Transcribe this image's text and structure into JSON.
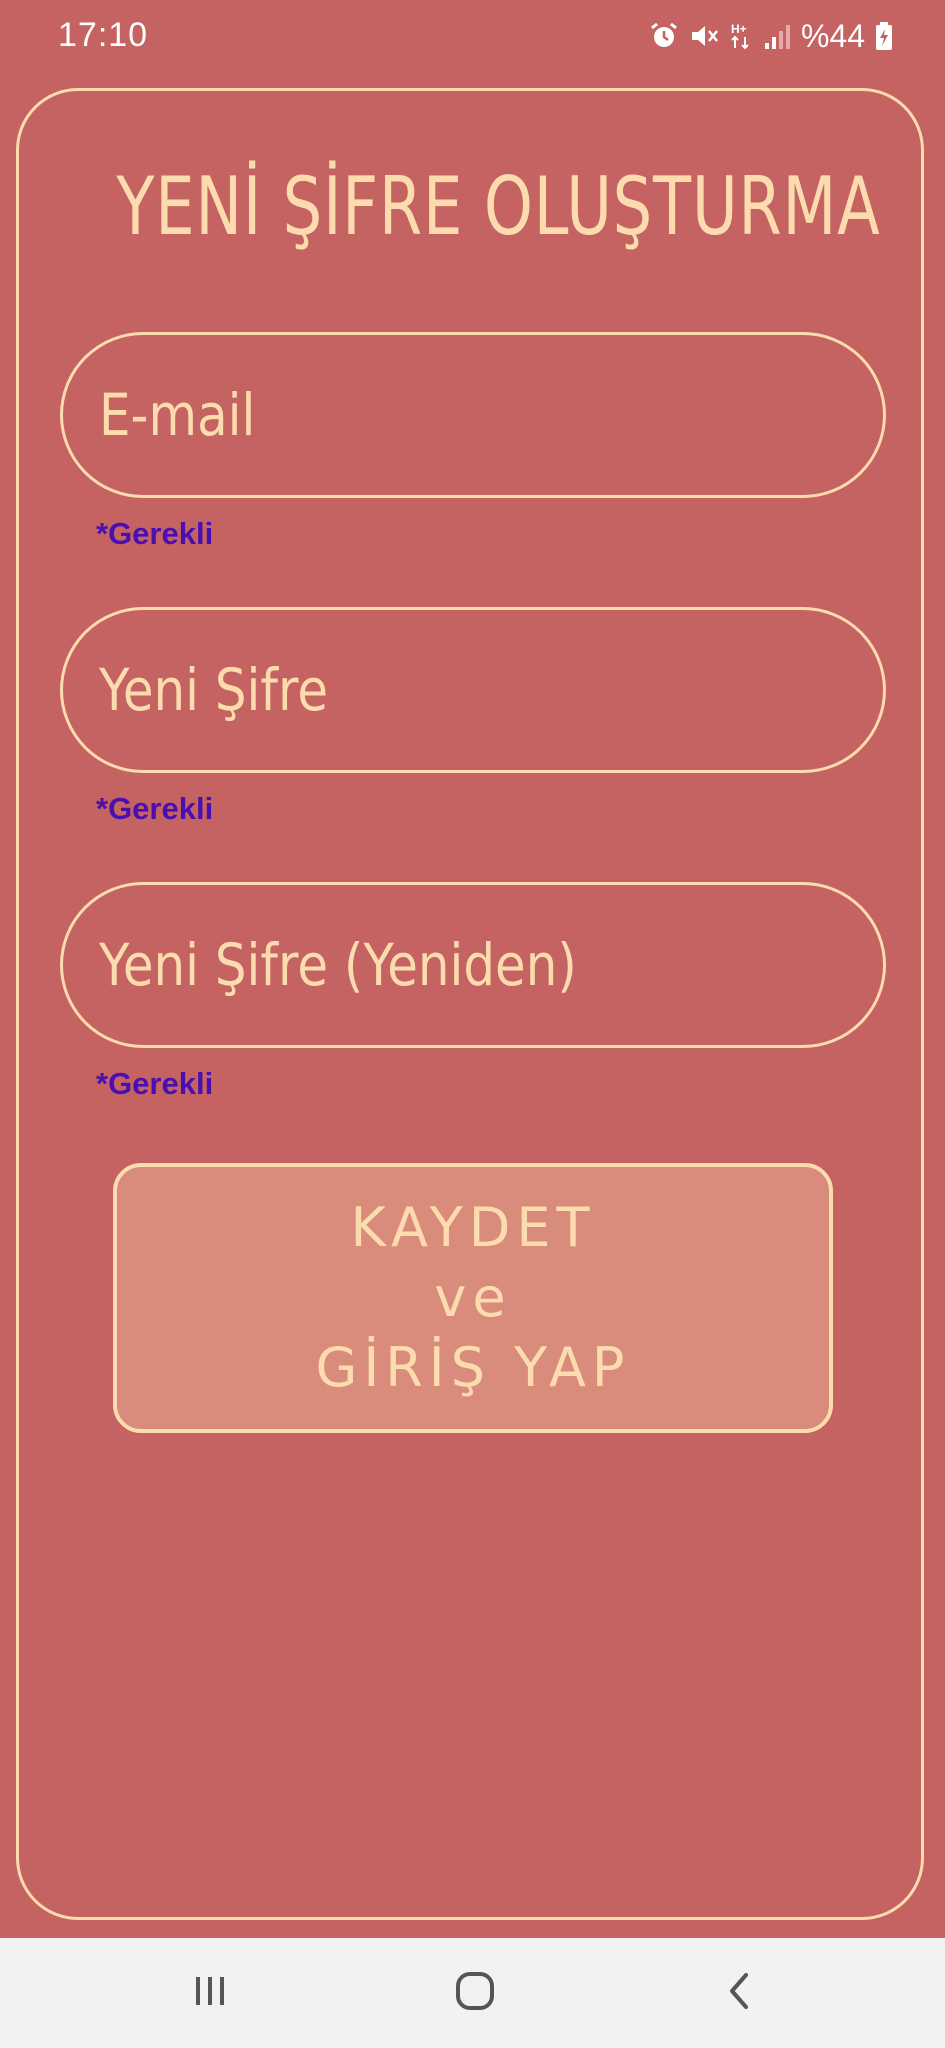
{
  "status_bar": {
    "time": "17:10",
    "icons": [
      "alarm-icon",
      "mute-icon",
      "network-data-icon",
      "signal-icon",
      "battery-icon"
    ],
    "battery_text": "%44"
  },
  "form": {
    "title": "YENİ ŞİFRE OLUŞTURMA",
    "fields": [
      {
        "placeholder": "E-mail",
        "value": "",
        "hint": "*Gerekli"
      },
      {
        "placeholder": "Yeni Şifre",
        "value": "",
        "hint": "*Gerekli"
      },
      {
        "placeholder": "Yeni Şifre (Yeniden)",
        "value": "",
        "hint": "*Gerekli"
      }
    ],
    "submit": {
      "line1": "KAYDET",
      "line2": "ve",
      "line3": "GİRİŞ YAP"
    }
  },
  "nav_bar": {
    "icons": [
      "recent-apps-icon",
      "home-icon",
      "back-icon"
    ]
  },
  "colors": {
    "background": "#c56262",
    "accent": "#fcdcae",
    "button": "#d98b7c",
    "hint": "#4a0fb0",
    "nav_background": "#f2f2f2"
  }
}
